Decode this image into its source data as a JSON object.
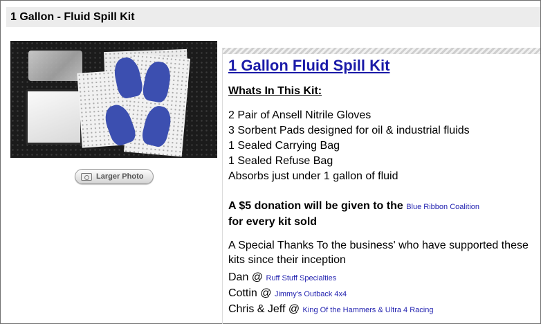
{
  "header": {
    "title": "1 Gallon - Fluid Spill Kit"
  },
  "photo_button": {
    "label": "Larger Photo"
  },
  "kit": {
    "title": "1 Gallon Fluid Spill Kit",
    "contents_heading": "Whats In This Kit:",
    "contents": [
      "2 Pair of Ansell Nitrile Gloves",
      "3 Sorbent Pads designed for oil & industrial fluids",
      "1 Sealed Carrying Bag",
      "1 Sealed Refuse Bag",
      "Absorbs just under 1 gallon of  fluid"
    ],
    "donation": {
      "prefix": "A $5 donation will be given to the",
      "link": "Blue Ribbon Coalition",
      "suffix": "for every kit sold"
    },
    "thanks": "A Special Thanks To the  business' who have supported these kits since their inception",
    "credits": [
      {
        "name": "Dan @",
        "link": "Ruff Stuff Specialties"
      },
      {
        "name": "Cottin @",
        "link": "Jimmy's Outback 4x4"
      },
      {
        "name": "Chris & Jeff @",
        "link": "King Of the Hammers & Ultra 4 Racing"
      }
    ]
  },
  "colors": {
    "link": "#1a1aa8",
    "header_bg": "#ececec"
  },
  "icons": {
    "camera": "camera-icon"
  }
}
